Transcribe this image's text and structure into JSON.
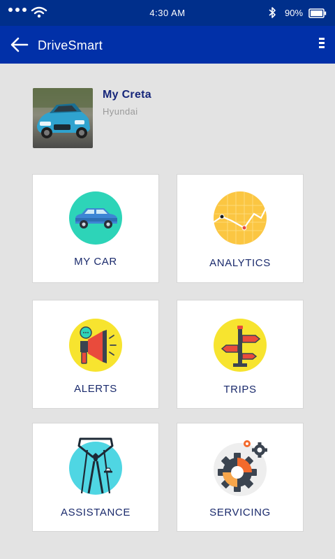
{
  "status_bar": {
    "time": "4:30 AM",
    "battery": "90%"
  },
  "app_bar": {
    "title": "DriveSmart",
    "back_icon": "arrow-left-icon",
    "menu_icon": "overflow-menu-icon"
  },
  "vehicle": {
    "name": "My Creta",
    "brand": "Hyundai"
  },
  "tiles": [
    {
      "label": "MY CAR",
      "icon": "car-icon"
    },
    {
      "label": "ANALYTICS",
      "icon": "analytics-icon"
    },
    {
      "label": "ALERTS",
      "icon": "megaphone-icon"
    },
    {
      "label": "TRIPS",
      "icon": "signpost-icon"
    },
    {
      "label": "ASSISTANCE",
      "icon": "suit-icon"
    },
    {
      "label": "SERVICING",
      "icon": "gears-icon"
    }
  ],
  "colors": {
    "status_bar": "#002f8b",
    "app_bar": "#0130a8",
    "background": "#e3e3e3",
    "label": "#1a2a6c",
    "teal": "#2dd4b8",
    "yellow": "#f7e42f",
    "orange": "#fbc642"
  }
}
